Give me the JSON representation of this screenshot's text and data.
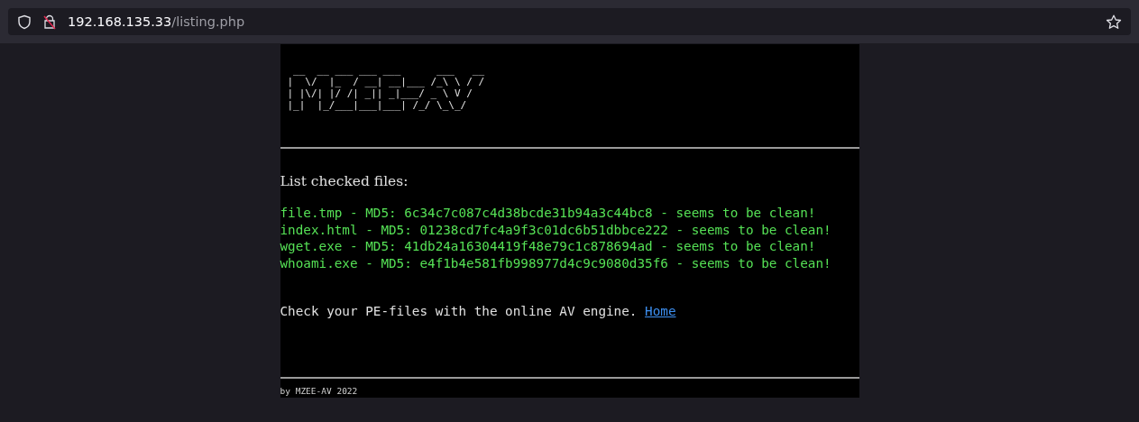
{
  "address_bar": {
    "host": "192.168.135.33",
    "path": "/listing.php"
  },
  "page": {
    "logo_lines": [
      " __  __ ___ ___ ___      ___   __",
      "|  \\/  |_  / __| __|___ /_\\ \\ / /",
      "| |\\/| |/ /| _|| _|___/ _ \\ V /",
      "|_|  |_/___|___|___| /_/ \\_\\_/"
    ],
    "heading": "List checked files:",
    "files": [
      "file.tmp - MD5: 6c34c7c087c4d38bcde31b94a3c44bc8 - seems to be clean!",
      "index.html - MD5: 01238cd7fc4a9f3c01dc6b51dbbce222 - seems to be clean!",
      "wget.exe - MD5: 41db24a16304419f48e79c1c878694ad - seems to be clean!",
      "whoami.exe - MD5: e4f1b4e581fb998977d4c9c9080d35f6 - seems to be clean!"
    ],
    "note": "Check your PE-files with the online AV engine.",
    "link": "Home",
    "footer": "by MZEE-AV 2022"
  }
}
